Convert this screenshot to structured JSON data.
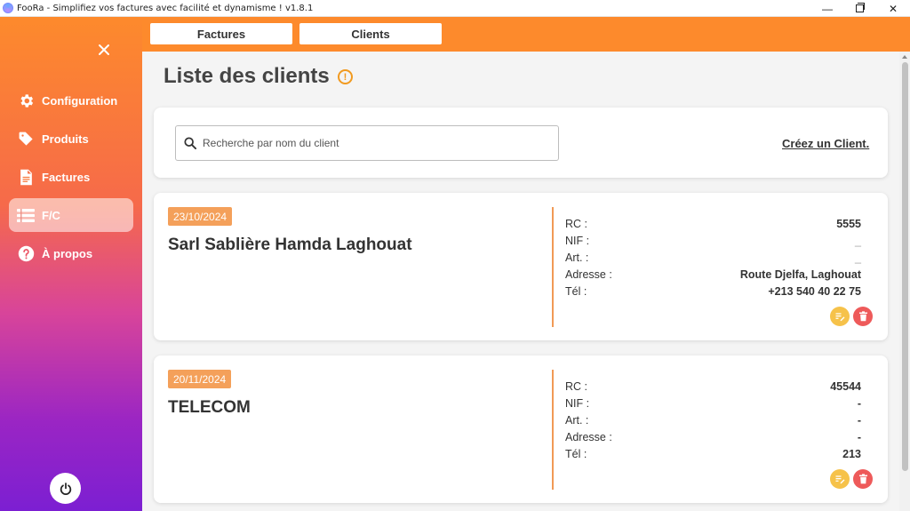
{
  "window": {
    "title": "FooRa - Simplifiez vos factures avec facilité et dynamisme ! v1.8.1",
    "minimize_glyph": "—",
    "close_glyph": "✕"
  },
  "sidebar": {
    "close_icon": "close-icon",
    "items": [
      {
        "label": "Configuration",
        "icon": "gear-icon"
      },
      {
        "label": "Produits",
        "icon": "tag-icon"
      },
      {
        "label": "Factures",
        "icon": "document-icon"
      },
      {
        "label": "F/C",
        "icon": "list-icon",
        "active": true
      },
      {
        "label": "À propos",
        "icon": "question-icon"
      }
    ],
    "power_icon": "power-icon"
  },
  "topnav": {
    "tabs": [
      {
        "label": "Factures"
      },
      {
        "label": "Clients"
      }
    ]
  },
  "main": {
    "title": "Liste des clients",
    "info_glyph": "!",
    "search": {
      "placeholder": "Recherche par nom du client",
      "value": ""
    },
    "create_link": "Créez un Client."
  },
  "clients": [
    {
      "date": "23/10/2024",
      "name": "Sarl Sablière Hamda Laghouat",
      "details": [
        {
          "label": "RC :",
          "value": "5555"
        },
        {
          "label": "NIF :",
          "value": "_"
        },
        {
          "label": "Art. :",
          "value": "_"
        },
        {
          "label": "Adresse :",
          "value": "Route Djelfa, Laghouat"
        },
        {
          "label": "Tél :",
          "value": "+213 540 40 22 75"
        }
      ]
    },
    {
      "date": "20/11/2024",
      "name": "TELECOM",
      "details": [
        {
          "label": "RC :",
          "value": "45544"
        },
        {
          "label": "NIF :",
          "value": "-"
        },
        {
          "label": "Art. :",
          "value": "-"
        },
        {
          "label": "Adresse :",
          "value": "-"
        },
        {
          "label": "Tél :",
          "value": "213"
        }
      ]
    }
  ],
  "colors": {
    "accent": "#fd8a2c",
    "badge": "#f4a05a",
    "edit": "#f6c24a",
    "delete": "#ee5a5a"
  }
}
